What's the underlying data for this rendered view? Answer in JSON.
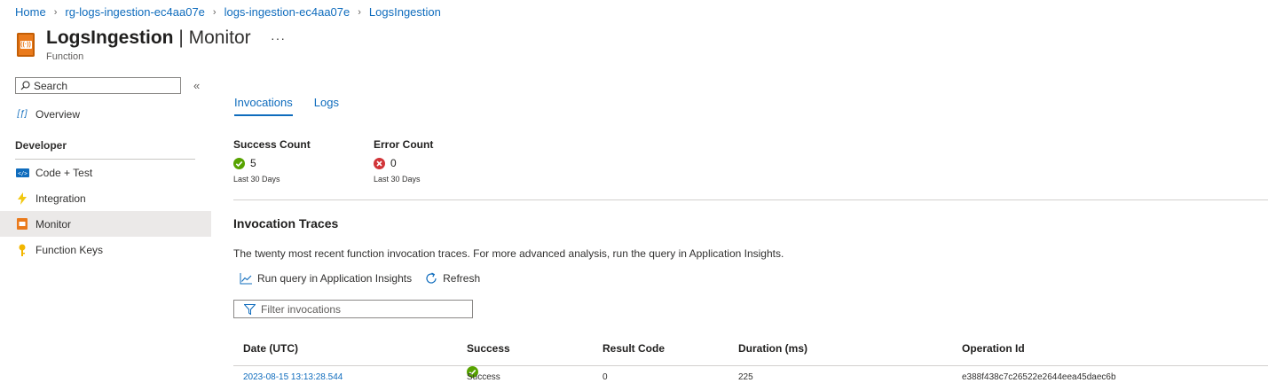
{
  "breadcrumb": [
    "Home",
    "rg-logs-ingestion-ec4aa07e",
    "logs-ingestion-ec4aa07e",
    "LogsIngestion"
  ],
  "header": {
    "resource_name": "LogsIngestion",
    "separator": " | ",
    "section": "Monitor",
    "more": "···",
    "subtitle": "Function"
  },
  "sidebar": {
    "search_placeholder": "Search",
    "collapse": "«",
    "overview": "Overview",
    "group": "Developer",
    "items": [
      {
        "label": "Code + Test",
        "icon": "code-icon"
      },
      {
        "label": "Integration",
        "icon": "lightning-icon"
      },
      {
        "label": "Monitor",
        "icon": "monitor-icon",
        "active": true
      },
      {
        "label": "Function Keys",
        "icon": "key-icon"
      }
    ]
  },
  "tabs": [
    "Invocations",
    "Logs"
  ],
  "metrics": {
    "success": {
      "label": "Success Count",
      "value": "5",
      "period": "Last 30 Days"
    },
    "error": {
      "label": "Error Count",
      "value": "0",
      "period": "Last 30 Days"
    }
  },
  "traces": {
    "title": "Invocation Traces",
    "description": "The twenty most recent function invocation traces. For more advanced analysis, run the query in Application Insights.",
    "run_query": "Run query in Application Insights",
    "refresh": "Refresh",
    "filter_placeholder": "Filter invocations"
  },
  "table": {
    "columns": [
      "Date (UTC)",
      "Success",
      "Result Code",
      "Duration (ms)",
      "Operation Id"
    ],
    "rows": [
      {
        "date": "2023-08-15 13:13:28.544",
        "success": "Success",
        "result_code": "0",
        "duration": "225",
        "operation_id": "e388f438c7c26522e2644eea45daec6b"
      }
    ]
  },
  "colors": {
    "accent": "#0f6cbd",
    "success": "#57a300",
    "error": "#d13438",
    "function_orange": "#ea7a1b"
  }
}
